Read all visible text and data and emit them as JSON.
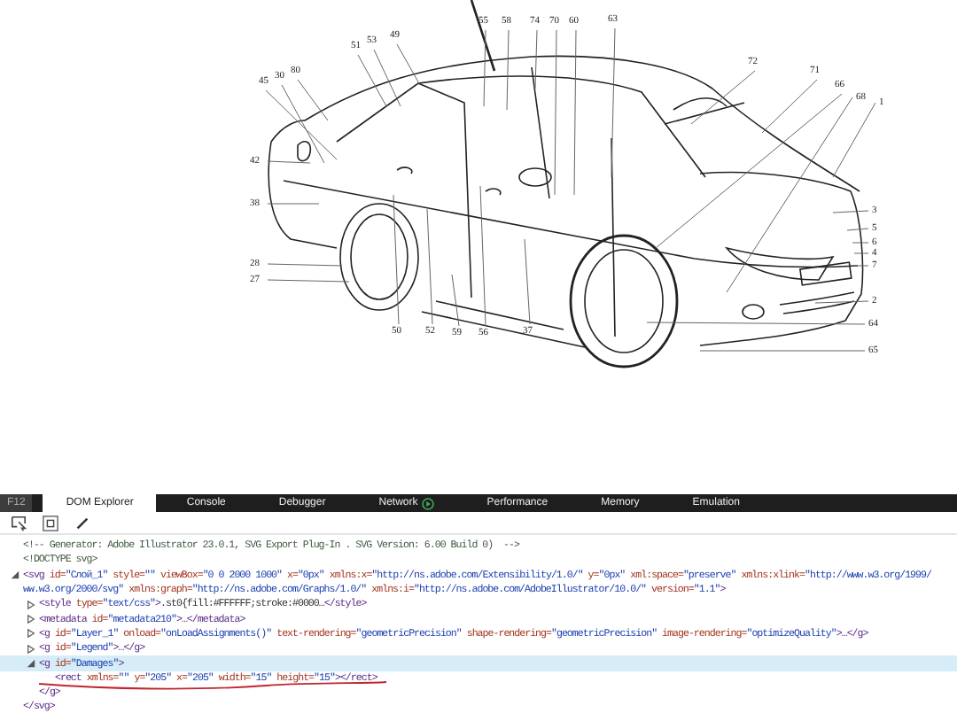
{
  "diagram": {
    "callouts": [
      "55",
      "58",
      "74",
      "70",
      "60",
      "63",
      "49",
      "53",
      "51",
      "80",
      "30",
      "45",
      "72",
      "71",
      "66",
      "68",
      "1",
      "42",
      "38",
      "3",
      "5",
      "6",
      "4",
      "7",
      "28",
      "27",
      "2",
      "64",
      "50",
      "52",
      "59",
      "56",
      "37",
      "65"
    ]
  },
  "devtools": {
    "f12_label": "F12",
    "tabs": [
      {
        "label": "DOM Explorer",
        "selected": true
      },
      {
        "label": "Console",
        "selected": false
      },
      {
        "label": "Debugger",
        "selected": false
      },
      {
        "label": "Network",
        "selected": false
      },
      {
        "label": "Performance",
        "selected": false
      },
      {
        "label": "Memory",
        "selected": false
      },
      {
        "label": "Emulation",
        "selected": false
      }
    ],
    "dom_tree": [
      {
        "selected": false,
        "tokens": [
          {
            "kind": "comment",
            "text": "<!-- Generator: Adobe Illustrator 23.0.1, SVG Export Plug-In . SVG Version: 6.00 Build 0)  -->"
          }
        ]
      },
      {
        "selected": false,
        "tokens": [
          {
            "kind": "comment",
            "text": "<!DOCTYPE svg>"
          }
        ]
      },
      {
        "selected": false,
        "expanded": true,
        "tokens": [
          {
            "kind": "tag",
            "text": "<svg"
          },
          {
            "kind": "attr",
            "text": " id="
          },
          {
            "kind": "value",
            "text": "\"Слой_1\""
          },
          {
            "kind": "attr",
            "text": " style="
          },
          {
            "kind": "value",
            "text": "\"\""
          },
          {
            "kind": "attr",
            "text": " viewBox="
          },
          {
            "kind": "value",
            "text": "\"0 0 2000 1000\""
          },
          {
            "kind": "attr",
            "text": " x="
          },
          {
            "kind": "value",
            "text": "\"0px\""
          },
          {
            "kind": "attr",
            "text": " xmlns:x="
          },
          {
            "kind": "value",
            "text": "\"http://ns.adobe.com/Extensibility/1.0/\""
          },
          {
            "kind": "attr",
            "text": " y="
          },
          {
            "kind": "value",
            "text": "\"0px\""
          },
          {
            "kind": "attr",
            "text": " xml:space="
          },
          {
            "kind": "value",
            "text": "\"preserve\""
          },
          {
            "kind": "attr",
            "text": " xmlns:xlink="
          },
          {
            "kind": "value",
            "text": "\"http://www.w3.org/1999/"
          }
        ],
        "wrap": [
          {
            "kind": "value",
            "text": "ww.w3.org/2000/svg\""
          },
          {
            "kind": "attr",
            "text": " xmlns:graph="
          },
          {
            "kind": "value",
            "text": "\"http://ns.adobe.com/Graphs/1.0/\""
          },
          {
            "kind": "attr",
            "text": " xmlns:i="
          },
          {
            "kind": "value",
            "text": "\"http://ns.adobe.com/AdobeIllustrator/10.0/\""
          },
          {
            "kind": "attr",
            "text": " version="
          },
          {
            "kind": "value",
            "text": "\"1.1\""
          },
          {
            "kind": "tag",
            "text": ">"
          }
        ],
        "children": [
          {
            "selected": false,
            "expanded": false,
            "tokens": [
              {
                "kind": "tag",
                "text": "<style"
              },
              {
                "kind": "attr",
                "text": " type="
              },
              {
                "kind": "value",
                "text": "\"text/css\""
              },
              {
                "kind": "tag",
                "text": ">"
              },
              {
                "kind": "text",
                "text": ".st0{fill:#FFFFFF;stroke:#0000…"
              },
              {
                "kind": "tag",
                "text": "</style>"
              }
            ]
          },
          {
            "selected": false,
            "expanded": false,
            "tokens": [
              {
                "kind": "tag",
                "text": "<metadata"
              },
              {
                "kind": "attr",
                "text": " id="
              },
              {
                "kind": "value",
                "text": "\"metadata210\""
              },
              {
                "kind": "tag",
                "text": ">…</metadata>"
              }
            ]
          },
          {
            "selected": false,
            "expanded": false,
            "tokens": [
              {
                "kind": "tag",
                "text": "<g"
              },
              {
                "kind": "attr",
                "text": " id="
              },
              {
                "kind": "value",
                "text": "\"Layer_1\""
              },
              {
                "kind": "attr",
                "text": " onload="
              },
              {
                "kind": "value",
                "text": "\"onLoadAssignments()\""
              },
              {
                "kind": "attr",
                "text": " text-rendering="
              },
              {
                "kind": "value",
                "text": "\"geometricPrecision\""
              },
              {
                "kind": "attr",
                "text": " shape-rendering="
              },
              {
                "kind": "value",
                "text": "\"geometricPrecision\""
              },
              {
                "kind": "attr",
                "text": " image-rendering="
              },
              {
                "kind": "value",
                "text": "\"optimizeQuality\""
              },
              {
                "kind": "tag",
                "text": ">…</g>"
              }
            ]
          },
          {
            "selected": false,
            "expanded": false,
            "tokens": [
              {
                "kind": "tag",
                "text": "<g"
              },
              {
                "kind": "attr",
                "text": " id="
              },
              {
                "kind": "value",
                "text": "\"Legend\""
              },
              {
                "kind": "tag",
                "text": ">…</g>"
              }
            ]
          },
          {
            "selected": true,
            "expanded": true,
            "tokens": [
              {
                "kind": "tag",
                "text": "<g"
              },
              {
                "kind": "attr",
                "text": " id="
              },
              {
                "kind": "value",
                "text": "\"Damages\""
              },
              {
                "kind": "tag",
                "text": ">"
              }
            ],
            "children": [
              {
                "selected": false,
                "tokens": [
                  {
                    "kind": "tag",
                    "text": "<rect"
                  },
                  {
                    "kind": "attr",
                    "text": " xmlns="
                  },
                  {
                    "kind": "value",
                    "text": "\"\""
                  },
                  {
                    "kind": "attr",
                    "text": " y="
                  },
                  {
                    "kind": "value",
                    "text": "\"205\""
                  },
                  {
                    "kind": "attr",
                    "text": " x="
                  },
                  {
                    "kind": "value",
                    "text": "\"205\""
                  },
                  {
                    "kind": "attr",
                    "text": " width="
                  },
                  {
                    "kind": "value",
                    "text": "\"15\""
                  },
                  {
                    "kind": "attr",
                    "text": " height="
                  },
                  {
                    "kind": "value",
                    "text": "\"15\""
                  },
                  {
                    "kind": "tag",
                    "text": "></rect>"
                  }
                ]
              }
            ],
            "close": [
              {
                "kind": "tag",
                "text": "</g>"
              }
            ]
          }
        ],
        "close": [
          {
            "kind": "tag",
            "text": "</svg>"
          }
        ]
      }
    ]
  }
}
